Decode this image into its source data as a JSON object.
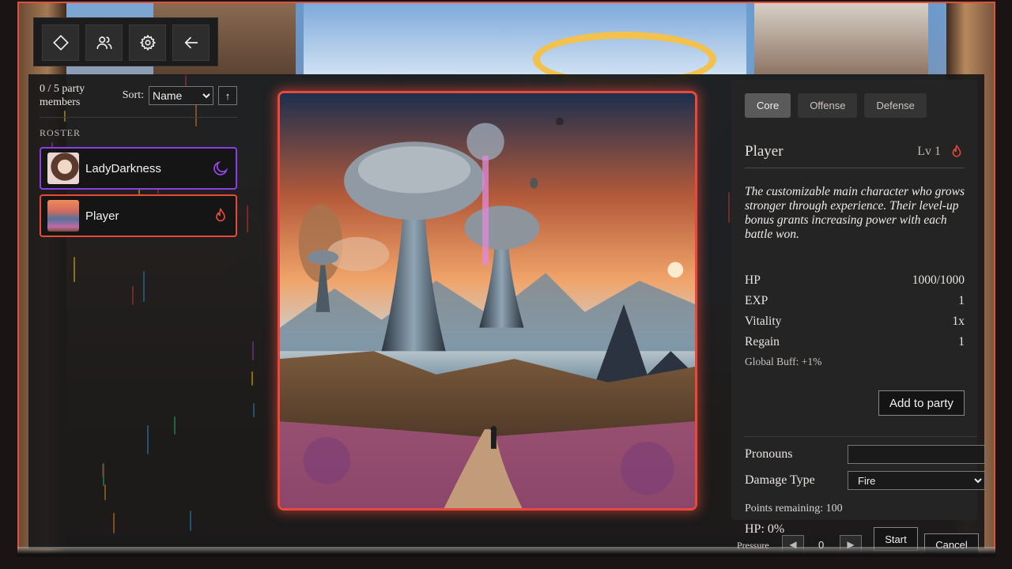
{
  "toolbar": {
    "buttons": [
      {
        "name": "diamond-icon"
      },
      {
        "name": "users-icon"
      },
      {
        "name": "gear-icon"
      },
      {
        "name": "back-arrow-icon"
      }
    ]
  },
  "roster": {
    "party_count": "0 / 5 party members",
    "sort_label": "Sort:",
    "sort_value": "Name",
    "sort_options": [
      "Name"
    ],
    "sort_direction": "↑",
    "title": "ROSTER",
    "items": [
      {
        "name": "LadyDarkness",
        "element": "moon-icon",
        "color": "#8a3fe0"
      },
      {
        "name": "Player",
        "element": "flame-icon",
        "color": "#e8493a"
      }
    ]
  },
  "detail": {
    "tabs": [
      {
        "label": "Core",
        "active": true
      },
      {
        "label": "Offense",
        "active": false
      },
      {
        "label": "Defense",
        "active": false
      }
    ],
    "name": "Player",
    "level": "Lv 1",
    "element_icon": "flame-icon",
    "description": "The customizable main character who grows stronger through experience. Their level-up bonus grants increasing power with each battle won.",
    "stats": [
      {
        "label": "HP",
        "value": "1000/1000"
      },
      {
        "label": "EXP",
        "value": "1"
      },
      {
        "label": "Vitality",
        "value": "1x"
      },
      {
        "label": "Regain",
        "value": "1"
      }
    ],
    "global_buff": "Global Buff: +1%",
    "add_button": "Add to party",
    "pronouns_label": "Pronouns",
    "pronouns_value": "",
    "damage_type_label": "Damage Type",
    "damage_type_value": "Fire",
    "damage_type_options": [
      "Fire"
    ],
    "points_remaining": "Points remaining: 100"
  },
  "footer": {
    "hp": "HP: 0%",
    "pressure_label": "Pressure",
    "pressure_value": "0",
    "prev": "◀",
    "next": "▶",
    "start": "Start",
    "cancel": "Cancel"
  },
  "colors": {
    "accent_fire": "#e8493a",
    "accent_dark": "#8a3fe0",
    "frame": "#e0513c"
  }
}
